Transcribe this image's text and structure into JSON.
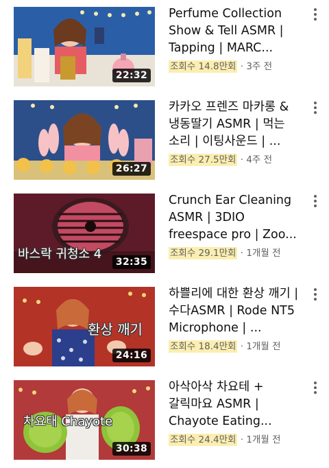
{
  "videos": [
    {
      "title": "Perfume Collection Show & Tell ASMR | Tapping | MARC...",
      "views": "조회수 14.8만회",
      "age": "3주 전",
      "duration": "22:32",
      "overlay_text": "",
      "colors": {
        "bg": "#2a5fa8",
        "accent": "#e6b23a"
      }
    },
    {
      "title": "카카오 프렌즈 마카롱 & 냉동딸기 ASMR | 먹는 소리 | 이팅사운드 | ...",
      "views": "조회수 27.5만회",
      "age": "4주 전",
      "duration": "26:27",
      "overlay_text": "",
      "colors": {
        "bg": "#2c4f8a",
        "accent": "#f2c14a"
      }
    },
    {
      "title": "Crunch Ear Cleaning ASMR | 3DIO freespace pro | Zoo...",
      "views": "조회수 29.1만회",
      "age": "1개월 전",
      "duration": "32:35",
      "overlay_text": "바스락 귀청소 4",
      "colors": {
        "bg": "#5b1a24",
        "accent": "#e04a6a"
      }
    },
    {
      "title": "하쁠리에 대한 환상 깨기 | 수다ASMR | Rode NT5 Microphone | ...",
      "views": "조회수 18.4만회",
      "age": "1개월 전",
      "duration": "24:16",
      "overlay_text": "환상 깨기",
      "colors": {
        "bg": "#c0392b",
        "accent": "#f5c84a"
      }
    },
    {
      "title": "아삭아삭 차요테 + 갈릭마요 ASMR | Chayote Eating...",
      "views": "조회수 24.4만회",
      "age": "1개월 전",
      "duration": "30:38",
      "overlay_text": "차요태 Chayote",
      "colors": {
        "bg": "#b23a3a",
        "accent": "#8fc43a"
      }
    }
  ],
  "separator": "·"
}
